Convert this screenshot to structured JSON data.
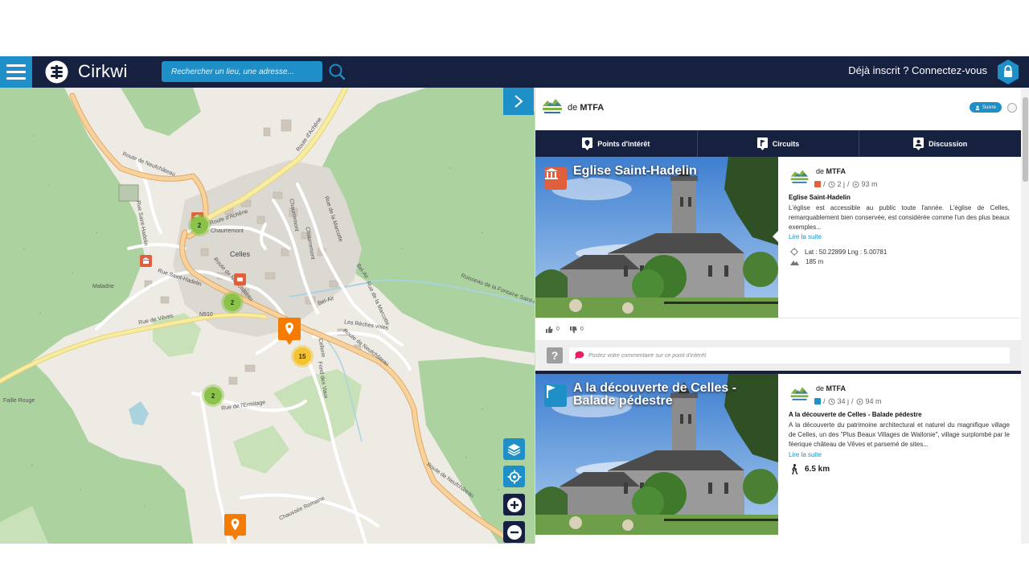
{
  "navbar": {
    "brand": "Cirkwi",
    "search_placeholder": "Rechercher un lieu, une adresse...",
    "login_text": "Déjà inscrit ? Connectez-vous"
  },
  "map": {
    "labels": {
      "route_neufchateau_top": "Route de Neufchâteau",
      "route_achene_1": "Route d'Achêne",
      "route_achene_2": "Route d'Achêne",
      "chaurremont_1": "Chaurremont",
      "chaurremont_2": "Chaurremont",
      "chaurremont_3": "Chaurremont",
      "rue_marcotte": "Rue de la Marcotte",
      "rue_marcotte_2": "Rue de la Marcotte",
      "rue_saint_hadelin_1": "Rue Saint-Hadelin",
      "rue_saint_hadelin_2": "Rue Saint-Hadelin",
      "celles": "Celles",
      "maladrie": "Maladrie",
      "route_neufchateau_mid": "Route de Neufchâteau",
      "rue_veves": "Rue de Vèves",
      "n910": "N910",
      "bel_air_1": "Bel-Air",
      "bel_air_2": "Bel-Air",
      "reches_voies": "Les Rèches voies",
      "ruisseau": "Ruisseau de la Fontaine Saint-Martin",
      "route_neufchateau_right": "Route de Neufchâteau",
      "cellerie": "Cellerie",
      "ermitage": "Rue de l'Ermitage",
      "fond_des_vaux": "Fond des Vaux",
      "faille_rouge": "Faille Rouge",
      "route_neufchateau_bottom": "Route de Neufchâteau",
      "chaussee_romaine": "Chaussée Romaine"
    },
    "clusters": [
      "2",
      "2",
      "15",
      "2"
    ]
  },
  "panel": {
    "header": {
      "from_prefix": "de",
      "org_name": "MTFA",
      "follow_label": "Suivre"
    },
    "tabs": [
      "Points d'intérêt",
      "Circuits",
      "Discussion"
    ],
    "cards": [
      {
        "title": "Eglise Saint-Hadelin",
        "from_prefix": "de",
        "org": "MTFA",
        "meta_duration": "2 j",
        "meta_distance": "93 m",
        "name": "Eglise Saint-Hadelin",
        "description": "L'église est accessible au public toute l'année. L'église de Celles, remarquablement bien conservée, est considérée comme l'un des plus beaux exemples...",
        "more": "Lire la suite",
        "coords": "Lat : 50.22899  Lng : 5.00781",
        "altitude": "185 m",
        "likes": "0",
        "dislikes": "0",
        "comment_placeholder": "Postez votre commentaire sur ce point d'intérêt"
      },
      {
        "title": "A la découverte de Celles - Balade pédestre",
        "from_prefix": "de",
        "org": "MTFA",
        "meta_duration": "34 j",
        "meta_distance": "94 m",
        "name": "A la découverte de Celles - Balade pédestre",
        "description": "A la découverte du patrimoine architectural et naturel du magnifique village de Celles, un des \"Plus Beaux Villages de Wallonie\", village surplombé par le féerique château de Vêves et parsemé de sites...",
        "more": "Lire la suite",
        "distance": "6.5 km"
      }
    ]
  },
  "colors": {
    "navbar": "#16213f",
    "accent": "#1e8fc7",
    "poi_orange": "#f57c00",
    "heritage_red": "#e0603e",
    "cluster_green": "#8bc34a",
    "cluster_yellow": "#f4c430"
  },
  "icons": {
    "menu": "hamburger-icon",
    "logo": "cirkwi-logo-icon",
    "search": "search-icon",
    "lock": "lock-icon",
    "collapse": "chevron-right-icon",
    "layers": "layers-icon",
    "locate": "locate-icon",
    "zoom_in": "plus-icon",
    "zoom_out": "minus-icon"
  }
}
